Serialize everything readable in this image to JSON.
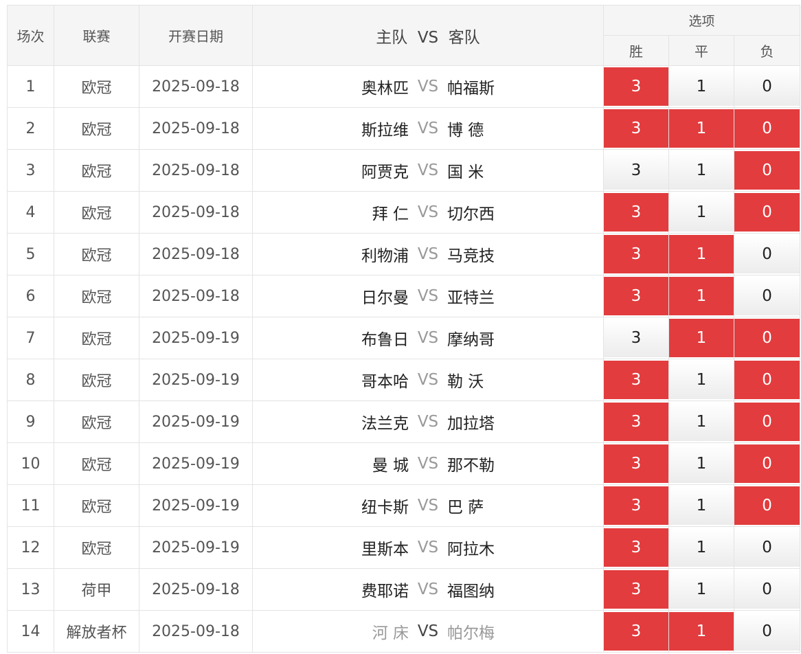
{
  "header": {
    "col_index": "场次",
    "col_league": "联赛",
    "col_date": "开赛日期",
    "col_matchup": "主队  VS  客队",
    "col_options": "选项",
    "opt_win": "胜",
    "opt_draw": "平",
    "opt_loss": "负"
  },
  "colors": {
    "selected": "#e23c3e",
    "unselected": "#f3f3f3"
  },
  "vs_label": "VS",
  "rows": [
    {
      "idx": "1",
      "league": "欧冠",
      "date": "2025-09-18",
      "home": "奥林匹",
      "away": "帕福斯",
      "w": "3",
      "d": "1",
      "l": "0",
      "sel": [
        true,
        false,
        false
      ]
    },
    {
      "idx": "2",
      "league": "欧冠",
      "date": "2025-09-18",
      "home": "斯拉维",
      "away": "博 德",
      "w": "3",
      "d": "1",
      "l": "0",
      "sel": [
        true,
        true,
        true
      ]
    },
    {
      "idx": "3",
      "league": "欧冠",
      "date": "2025-09-18",
      "home": "阿贾克",
      "away": "国 米",
      "w": "3",
      "d": "1",
      "l": "0",
      "sel": [
        false,
        false,
        true
      ]
    },
    {
      "idx": "4",
      "league": "欧冠",
      "date": "2025-09-18",
      "home": "拜 仁",
      "away": "切尔西",
      "w": "3",
      "d": "1",
      "l": "0",
      "sel": [
        true,
        false,
        true
      ]
    },
    {
      "idx": "5",
      "league": "欧冠",
      "date": "2025-09-18",
      "home": "利物浦",
      "away": "马竞技",
      "w": "3",
      "d": "1",
      "l": "0",
      "sel": [
        true,
        true,
        false
      ]
    },
    {
      "idx": "6",
      "league": "欧冠",
      "date": "2025-09-18",
      "home": "日尔曼",
      "away": "亚特兰",
      "w": "3",
      "d": "1",
      "l": "0",
      "sel": [
        true,
        true,
        false
      ]
    },
    {
      "idx": "7",
      "league": "欧冠",
      "date": "2025-09-19",
      "home": "布鲁日",
      "away": "摩纳哥",
      "w": "3",
      "d": "1",
      "l": "0",
      "sel": [
        false,
        true,
        true
      ]
    },
    {
      "idx": "8",
      "league": "欧冠",
      "date": "2025-09-19",
      "home": "哥本哈",
      "away": "勒 沃",
      "w": "3",
      "d": "1",
      "l": "0",
      "sel": [
        true,
        false,
        true
      ]
    },
    {
      "idx": "9",
      "league": "欧冠",
      "date": "2025-09-19",
      "home": "法兰克",
      "away": "加拉塔",
      "w": "3",
      "d": "1",
      "l": "0",
      "sel": [
        true,
        false,
        true
      ]
    },
    {
      "idx": "10",
      "league": "欧冠",
      "date": "2025-09-19",
      "home": "曼 城",
      "away": "那不勒",
      "w": "3",
      "d": "1",
      "l": "0",
      "sel": [
        true,
        false,
        true
      ]
    },
    {
      "idx": "11",
      "league": "欧冠",
      "date": "2025-09-19",
      "home": "纽卡斯",
      "away": "巴 萨",
      "w": "3",
      "d": "1",
      "l": "0",
      "sel": [
        true,
        false,
        true
      ]
    },
    {
      "idx": "12",
      "league": "欧冠",
      "date": "2025-09-19",
      "home": "里斯本",
      "away": "阿拉木",
      "w": "3",
      "d": "1",
      "l": "0",
      "sel": [
        true,
        false,
        false
      ]
    },
    {
      "idx": "13",
      "league": "荷甲",
      "date": "2025-09-18",
      "home": "费耶诺",
      "away": "福图纳",
      "w": "3",
      "d": "1",
      "l": "0",
      "sel": [
        true,
        false,
        false
      ]
    },
    {
      "idx": "14",
      "league": "解放者杯",
      "date": "2025-09-18",
      "home": "河 床",
      "away": "帕尔梅",
      "w": "3",
      "d": "1",
      "l": "0",
      "sel": [
        true,
        true,
        false
      ],
      "muted": true
    }
  ]
}
